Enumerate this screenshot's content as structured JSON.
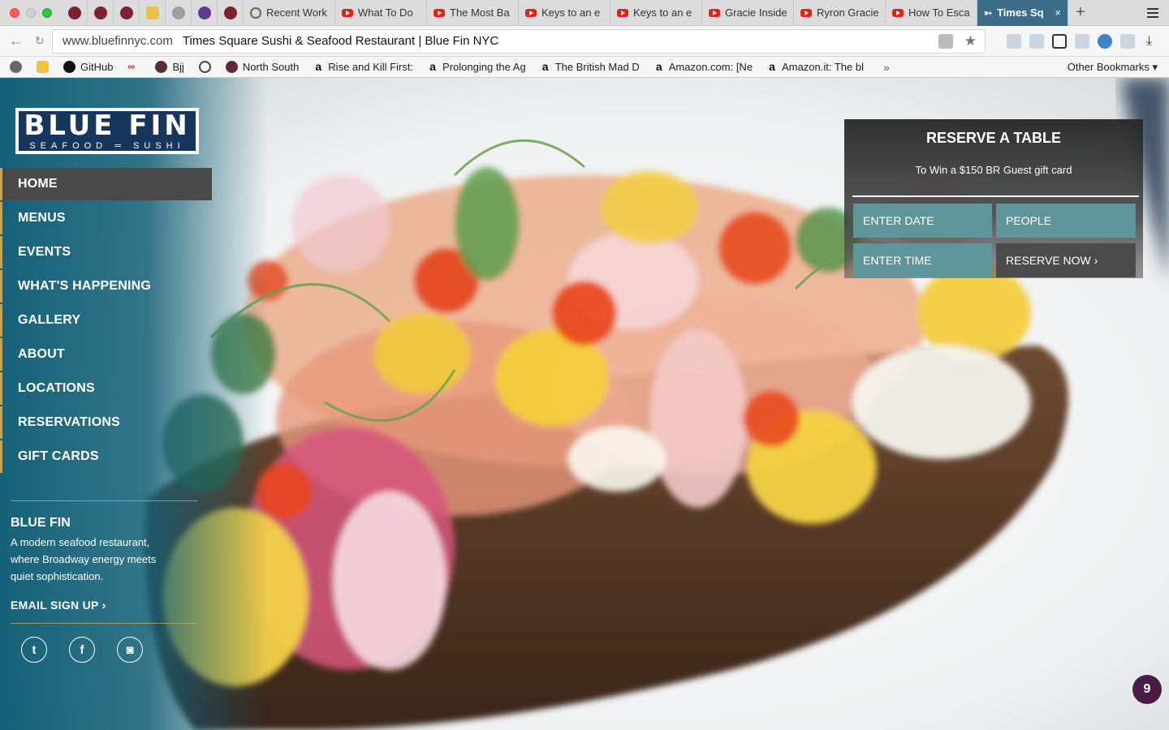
{
  "browser": {
    "tabs": [
      {
        "label": "Recent Work",
        "icon": "github-icon"
      },
      {
        "label": "What To Do",
        "icon": "youtube-icon"
      },
      {
        "label": "The Most Ba",
        "icon": "youtube-icon"
      },
      {
        "label": "Keys to an e",
        "icon": "youtube-icon"
      },
      {
        "label": "Keys to an e",
        "icon": "youtube-icon"
      },
      {
        "label": "Gracie Inside",
        "icon": "youtube-icon"
      },
      {
        "label": "Ryron Gracie",
        "icon": "youtube-icon"
      },
      {
        "label": "How To Esca",
        "icon": "youtube-icon"
      }
    ],
    "active_tab": {
      "label": "Times Sq",
      "close": "×"
    },
    "new_tab": "+",
    "url_host": "www.bluefinnyc.com",
    "url_title": "Times Square Sushi & Seafood Restaurant | Blue Fin NYC",
    "bookmarks": [
      {
        "label": "GitHub",
        "icon": "github-icon"
      },
      {
        "label": "",
        "icon": "red-logo-icon"
      },
      {
        "label": "Bjj",
        "icon": "bjj-icon"
      },
      {
        "label": "",
        "icon": "globe-icon"
      },
      {
        "label": "North South",
        "icon": "bjj-icon"
      },
      {
        "label": "Rise and Kill First:",
        "icon": "amazon-icon"
      },
      {
        "label": "Prolonging the Ag",
        "icon": "amazon-icon"
      },
      {
        "label": "The British Mad D",
        "icon": "amazon-icon"
      },
      {
        "label": "Amazon.com: [Ne",
        "icon": "amazon-icon"
      },
      {
        "label": "Amazon.it: The bl",
        "icon": "amazon-icon"
      }
    ],
    "bookmarks_more": "»",
    "other_bookmarks": "Other Bookmarks ▾"
  },
  "site": {
    "logo_main": "BLUE FIN",
    "logo_sub": "SEAFOOD ═ SUSHI",
    "nav": [
      {
        "label": "HOME",
        "active": true
      },
      {
        "label": "MENUS"
      },
      {
        "label": "EVENTS"
      },
      {
        "label": "WHAT'S HAPPENING"
      },
      {
        "label": "GALLERY"
      },
      {
        "label": "ABOUT"
      },
      {
        "label": "LOCATIONS"
      },
      {
        "label": "RESERVATIONS"
      },
      {
        "label": "GIFT CARDS"
      }
    ],
    "info_title": "BLUE FIN",
    "info_desc": "A modern seafood restaurant, where Broadway energy meets quiet sophistication.",
    "email_signup": "EMAIL SIGN UP ›",
    "social": [
      {
        "name": "twitter-icon",
        "glyph": "t"
      },
      {
        "name": "facebook-icon",
        "glyph": "f"
      },
      {
        "name": "instagram-icon",
        "glyph": "◙"
      }
    ],
    "reserve": {
      "title": "RESERVE A TABLE",
      "subtitle": "To Win a $150 BR Guest gift card",
      "date_label": "ENTER DATE",
      "people_label": "PEOPLE",
      "time_label": "ENTER TIME",
      "reserve_label": "RESERVE NOW ›"
    },
    "badge_count": "9",
    "colors": {
      "sidebar": "#0a5a73",
      "accent": "#c3a55a",
      "reserve_btn": "#5f969c",
      "logo_bg": "#17365e"
    }
  }
}
